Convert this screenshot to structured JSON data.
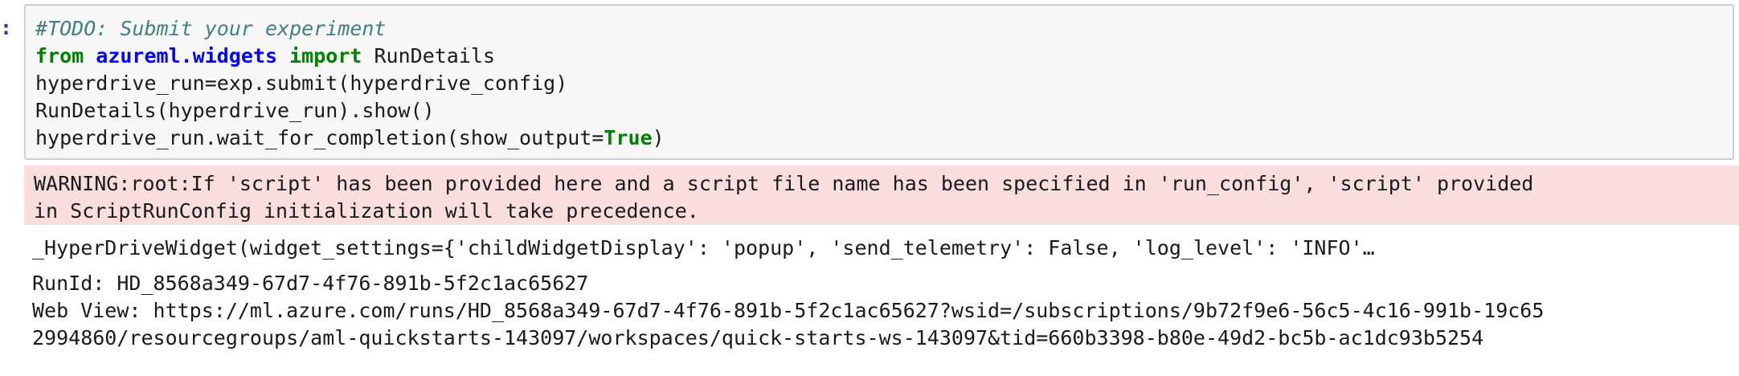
{
  "cell": {
    "prompt": ":",
    "code": {
      "line1_comment": "#TODO: Submit your experiment",
      "line2_from": "from",
      "line2_module": "azureml.widgets",
      "line2_import": "import",
      "line2_name": " RunDetails",
      "line3": "hyperdrive_run=exp.submit(hyperdrive_config)",
      "line4": "RunDetails(hyperdrive_run).show()",
      "line5_pre": "hyperdrive_run.wait_for_completion(show_output=",
      "line5_true": "True",
      "line5_post": ")"
    }
  },
  "outputs": {
    "warning_line1": "WARNING:root:If 'script' has been provided here and a script file name has been specified in 'run_config', 'script' provided",
    "warning_line2": "in ScriptRunConfig initialization will take precedence.",
    "widget_text": "_HyperDriveWidget(widget_settings={'childWidgetDisplay': 'popup', 'send_telemetry': False, 'log_level': 'INFO'…",
    "run_id": "RunId: HD_8568a349-67d7-4f76-891b-5f2c1ac65627",
    "web_view_line1": "Web View: https://ml.azure.com/runs/HD_8568a349-67d7-4f76-891b-5f2c1ac65627?wsid=/subscriptions/9b72f9e6-56c5-4c16-991b-19c65",
    "web_view_line2": "2994860/resourcegroups/aml-quickstarts-143097/workspaces/quick-starts-ws-143097&tid=660b3398-b80e-49d2-bc5b-ac1dc93b5254"
  },
  "colors": {
    "comment": "#408080",
    "keyword": "#008000",
    "module": "#0000ff",
    "stderr_bg": "#fadddd",
    "input_bg": "#f7f7f7"
  }
}
